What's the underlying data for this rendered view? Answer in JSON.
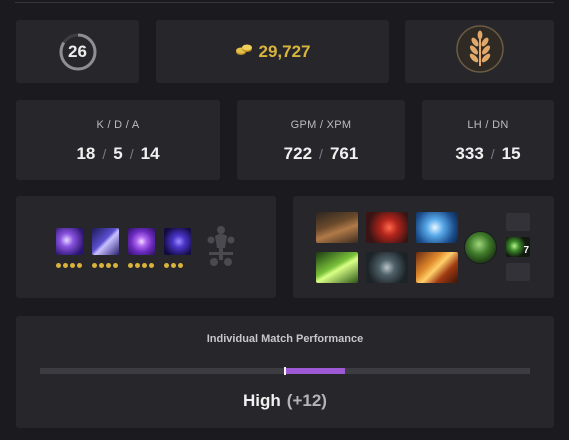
{
  "hero": {
    "level": "26",
    "level_icon": "level-ring"
  },
  "gold": {
    "value": "29,727",
    "icon": "gold-coins-icon",
    "color": "#d9b53b"
  },
  "badge": {
    "icon": "wheat-laurel-icon"
  },
  "stats": {
    "kda": {
      "label": "K / D / A",
      "kills": "18",
      "deaths": "5",
      "assists": "14",
      "sep": "/"
    },
    "gpm_xpm": {
      "label": "GPM / XPM",
      "gpm": "722",
      "xpm": "761",
      "sep": "/"
    },
    "lh_dn": {
      "label": "LH / DN",
      "lh": "333",
      "dn": "15",
      "sep": "/"
    }
  },
  "abilities": [
    {
      "icon": "void-vortex-icon",
      "levels": 4
    },
    {
      "icon": "shadow-wave-icon",
      "levels": 4
    },
    {
      "icon": "spiral-icon",
      "levels": 4
    },
    {
      "icon": "dark-orb-icon",
      "levels": 3
    }
  ],
  "talent_icon": "talent-tree-icon",
  "items": {
    "slots": [
      {
        "icon": "boots-icon"
      },
      {
        "icon": "blood-claw-icon"
      },
      {
        "icon": "lightning-icon"
      },
      {
        "icon": "green-blade-icon"
      },
      {
        "icon": "skull-mask-icon"
      },
      {
        "icon": "crossed-swords-icon"
      }
    ],
    "neutral": {
      "icon": "neutral-hood-icon"
    },
    "consumable": {
      "icon": "green-orb-icon",
      "count": "7"
    }
  },
  "performance": {
    "title": "Individual Match Performance",
    "rating": "High",
    "delta": "(+12)",
    "bar_start": 0.5,
    "bar_end": 0.622,
    "bar_color": "#9d5ad4"
  }
}
